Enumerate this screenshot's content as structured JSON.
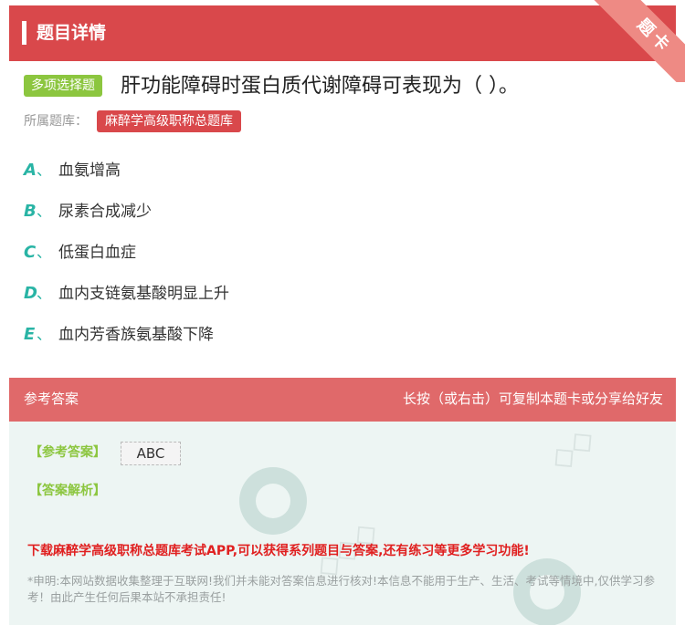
{
  "header": {
    "title": "题目详情",
    "ribbon": "题卡"
  },
  "question": {
    "type_tag": "多项选择题",
    "text": "肝功能障碍时蛋白质代谢障碍可表现为（ ）。",
    "source_label": "所属题库：",
    "source_value": "麻醉学高级职称总题库"
  },
  "options": [
    {
      "letter": "A",
      "sep": "、",
      "text": "血氨增高"
    },
    {
      "letter": "B",
      "sep": "、",
      "text": "尿素合成减少"
    },
    {
      "letter": "C",
      "sep": "、",
      "text": "低蛋白血症"
    },
    {
      "letter": "D",
      "sep": "、",
      "text": "血内支链氨基酸明显上升"
    },
    {
      "letter": "E",
      "sep": "、",
      "text": "血内芳香族氨基酸下降"
    }
  ],
  "answer_section": {
    "title": "参考答案",
    "hint": "长按（或右击）可复制本题卡或分享给好友",
    "answer_label": "【参考答案】",
    "answer_value": "ABC",
    "analysis_label": "【答案解析】",
    "promo": "下载麻醉学高级职称总题库考试APP,可以获得系列题目与答案,还有练习等更多学习功能!",
    "disclaimer": "*申明:本网站数据收集整理于互联网!我们并未能对答案信息进行核对!本信息不能用于生产、生活、考试等情境中,仅供学习参考！由此产生任何后果本站不承担责任!"
  },
  "colors": {
    "brand_red": "#d9484b",
    "green": "#8cc63f",
    "teal": "#29b4a5"
  }
}
